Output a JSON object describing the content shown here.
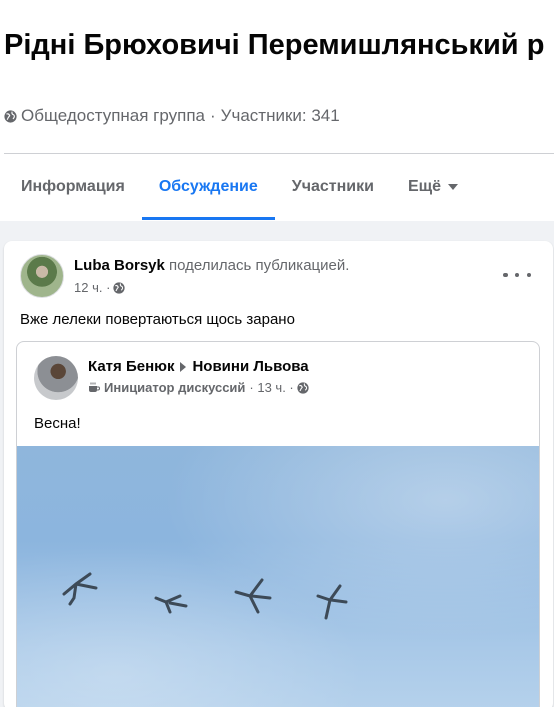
{
  "group": {
    "title": "Рідні Брюховичі Перемишлянський р",
    "privacy": "Общедоступная группа",
    "separator": "·",
    "members_label": "Участники: 341"
  },
  "tabs": [
    {
      "label": "Информация",
      "active": false
    },
    {
      "label": "Обсуждение",
      "active": true
    },
    {
      "label": "Участники",
      "active": false
    },
    {
      "label": "Ещё",
      "active": false
    }
  ],
  "post": {
    "author": "Luba Borsyk",
    "action": "поделилась публикацией.",
    "time": "12 ч. ·",
    "text": "Вже лелеки повертаються  щось зарано",
    "shared": {
      "author": "Катя Бенюк",
      "target": "Новини Львова",
      "badge": "Инициатор дискуссий",
      "time": "· 13 ч. ·",
      "text": "Весна!"
    }
  },
  "colors": {
    "accent": "#1877f2",
    "secondary_text": "#65676b",
    "background": "#f0f2f5"
  },
  "icons": [
    "globe-icon",
    "chevron-down-icon",
    "more-options-icon",
    "arrow-right-icon",
    "coffee-cup-icon"
  ]
}
